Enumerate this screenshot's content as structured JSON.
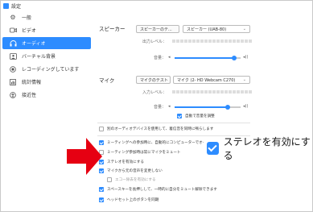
{
  "window": {
    "title": "設定"
  },
  "sidebar": {
    "items": [
      {
        "label": "一般",
        "icon": "gear-icon",
        "active": false
      },
      {
        "label": "ビデオ",
        "icon": "video-camera-icon",
        "active": false
      },
      {
        "label": "オーディオ",
        "icon": "headphones-icon",
        "active": true
      },
      {
        "label": "バーチャル背景",
        "icon": "person-background-icon",
        "active": false
      },
      {
        "label": "レコーディングしています",
        "icon": "record-icon",
        "active": false
      },
      {
        "label": "統計情報",
        "icon": "statistics-icon",
        "active": false
      },
      {
        "label": "接近性",
        "icon": "accessibility-icon",
        "active": false
      }
    ]
  },
  "speaker": {
    "label": "スピーカー",
    "test_button": "スピーカーのテ...",
    "device": "スピーカー (UAB-80)",
    "output_level_label": "出力レベル：",
    "volume_label": "音量：",
    "volume": 0.9
  },
  "mic": {
    "label": "マイク",
    "test_button": "マイクのテスト",
    "device": "マイク (2- HD Webcam C270)",
    "input_level_label": "入力レベル：",
    "volume_label": "音量：",
    "volume": 0.8,
    "auto_adjust_label": "自動で音量を調整"
  },
  "options": [
    {
      "label": "別のオーディオデバイスを使用して、着信音を同時に鳴らします",
      "checked": false,
      "indent": false
    },
    {
      "label": "ミーティングへの参加時に、自動的にコンピューターでオーディオに参加",
      "checked": true,
      "indent": false
    },
    {
      "label": "ミーティング参加時は常にマイクをミュート",
      "checked": false,
      "indent": false
    },
    {
      "label": "ステレオを有効にする",
      "checked": true,
      "indent": false
    },
    {
      "label": "マイクから元の音声を変更しない",
      "checked": true,
      "indent": false
    },
    {
      "label": "エコー除去を有効にする",
      "checked": false,
      "indent": true
    },
    {
      "label": "スペースキーを長押しして、一時的に自分をミュート解除できます",
      "checked": true,
      "indent": false
    },
    {
      "label": "ヘッドセット上のボタンを同期",
      "checked": true,
      "indent": false
    }
  ],
  "callout": {
    "label": "ステレオを有効にする",
    "checked": true
  },
  "colors": {
    "accent": "#2d8cff",
    "arrow": "#e60012"
  }
}
